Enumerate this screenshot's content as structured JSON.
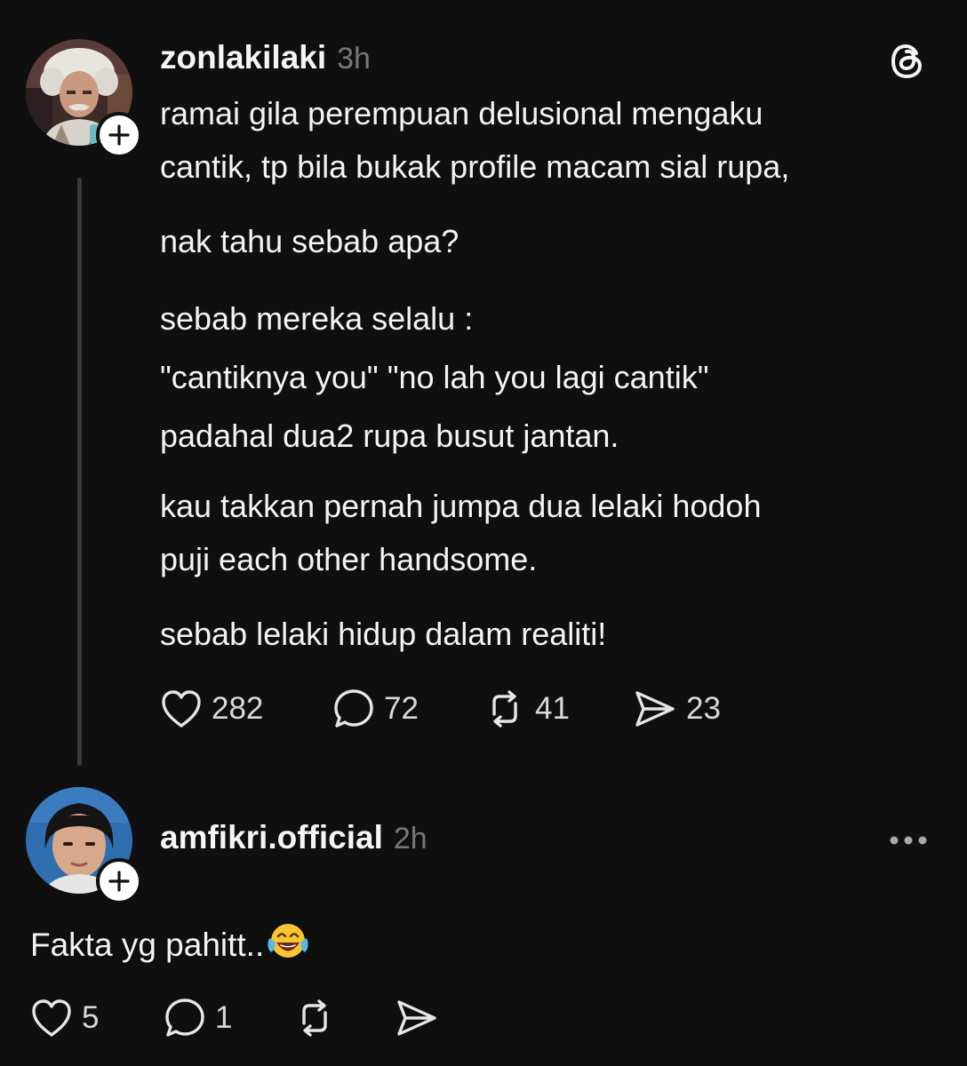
{
  "post": {
    "username": "zonlakilaki",
    "time": "3h",
    "paragraphs": [
      "ramai gila perempuan delusional mengaku",
      "cantik, tp bila bukak profile macam sial rupa,",
      "nak tahu sebab apa?",
      "sebab mereka selalu :",
      "\"cantiknya you\" \"no lah you lagi cantik\"",
      "padahal dua2 rupa busut jantan.",
      "kau takkan pernah jumpa dua lelaki hodoh",
      "puji each other handsome.",
      "sebab lelaki hidup dalam realiti!"
    ],
    "counts": {
      "likes": "282",
      "replies": "72",
      "reposts": "41",
      "shares": "23"
    }
  },
  "reply": {
    "username": "amfikri.official",
    "time": "2h",
    "text": "Fakta yg pahitt..",
    "emoji": "face-with-tears-of-joy",
    "counts": {
      "likes": "5",
      "replies": "1"
    }
  },
  "icons": {
    "brand": "threads-logo-icon",
    "more": "more-options-icon",
    "like": "heart-icon",
    "reply": "comment-bubble-icon",
    "repost": "repost-icon",
    "share": "send-icon",
    "follow": "plus-icon"
  },
  "colors": {
    "background": "#0f0f0f",
    "text": "#f3f3f3",
    "muted": "#777777",
    "thread_line": "#3a3a3a"
  }
}
